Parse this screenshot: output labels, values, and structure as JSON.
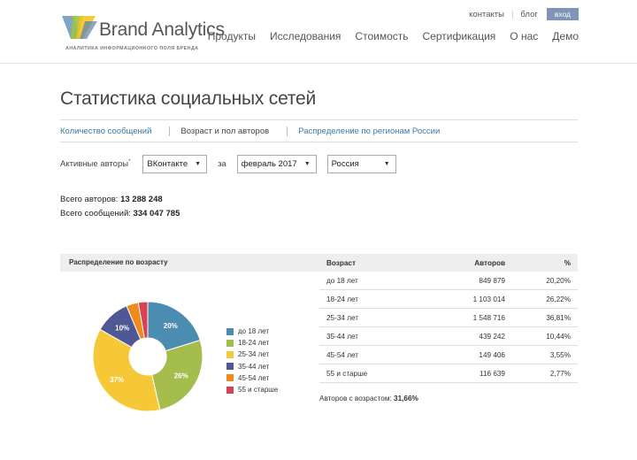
{
  "header": {
    "brand": "Brand Analytics",
    "tagline": "АНАЛИТИКА ИНФОРМАЦИОННОГО ПОЛЯ БРЕНДА",
    "top_links": [
      "контакты",
      "блог"
    ],
    "login": "вход",
    "nav": [
      "Продукты",
      "Исследования",
      "Стоимость",
      "Сертификация",
      "О нас",
      "Демо"
    ]
  },
  "page": {
    "title": "Статистика социальных сетей",
    "tabs": [
      "Количество сообщений",
      "Возраст и пол авторов",
      "Распределение по регионам России"
    ],
    "active_tab": 1
  },
  "filters": {
    "label": "Активные авторы",
    "label_mark": "*",
    "network": "ВКонтакте",
    "for_label": "за",
    "period": "февраль 2017",
    "region": "Россия"
  },
  "totals": {
    "authors_label": "Всего авторов:",
    "authors_value": "13 288 248",
    "messages_label": "Всего сообщений:",
    "messages_value": "334 047 785"
  },
  "distribution": {
    "title": "Распределение по возрасту",
    "columns": [
      "Возраст",
      "Авторов",
      "%"
    ],
    "rows": [
      [
        "до 18 лет",
        "849 879",
        "20,20%"
      ],
      [
        "18-24 лет",
        "1 103 014",
        "26,22%"
      ],
      [
        "25-34 лет",
        "1 548 716",
        "36,81%"
      ],
      [
        "35-44 лет",
        "439 242",
        "10,44%"
      ],
      [
        "45-54 лет",
        "149 406",
        "3,55%"
      ],
      [
        "55 и старше",
        "116 639",
        "2,77%"
      ]
    ],
    "footer_label": "Авторов с возрастом:",
    "footer_value": "31,66%"
  },
  "chart_data": {
    "type": "pie",
    "categories": [
      "до 18 лет",
      "18-24 лет",
      "25-34 лет",
      "35-44 лет",
      "45-54 лет",
      "55 и старше"
    ],
    "values": [
      20.2,
      26.22,
      36.81,
      10.44,
      3.55,
      2.77
    ],
    "slice_labels": [
      "20%",
      "26%",
      "37%",
      "10%",
      "",
      ""
    ],
    "colors": [
      "#4a8db0",
      "#a4bd4c",
      "#f6c736",
      "#4f5795",
      "#f08a1c",
      "#d64254"
    ],
    "legend_position": "right",
    "donut": true
  }
}
